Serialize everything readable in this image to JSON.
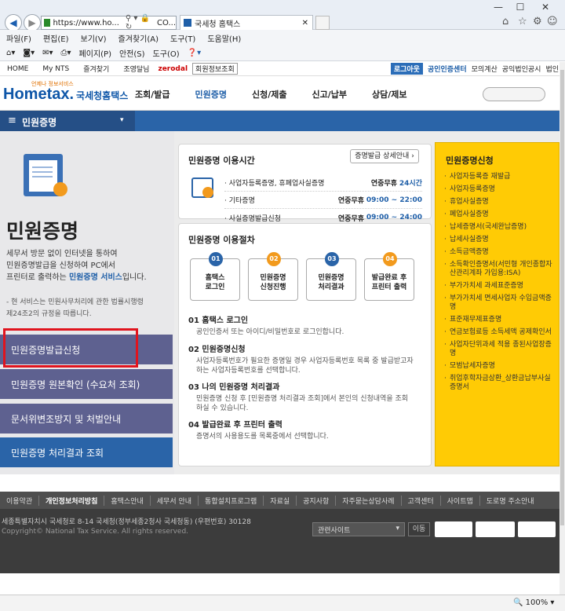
{
  "browser": {
    "address": "https://www.ho...",
    "address_extra": "CO...",
    "tab_title": "국세청 홈택스",
    "menu": [
      "파일(F)",
      "편집(E)",
      "보기(V)",
      "즐겨찾기(A)",
      "도구(T)",
      "도움말(H)"
    ],
    "commands": [
      "페이지(P)",
      "안전(S)",
      "도구(O)"
    ],
    "zoom": "100%"
  },
  "util_bar": {
    "items": [
      "HOME",
      "My NTS",
      "즐겨찾기",
      "조영달님",
      "zerodal",
      "회원정보조회"
    ],
    "right": [
      "로그아웃",
      "공인인증센터",
      "모의계산",
      "공익법인공시",
      "법인"
    ]
  },
  "header": {
    "logo": "Hometax.",
    "logo_small": "국세청홈택스",
    "logo_top": "언제나 정보서비스",
    "nav": [
      "조회/발급",
      "민원증명",
      "신청/제출",
      "신고/납부",
      "상담/제보"
    ]
  },
  "menubar": {
    "current": "민원증명"
  },
  "left": {
    "title": "민원증명",
    "desc1": "세무서 방문 없이 인터넷을 통하여",
    "desc2": "민원증명발급을 신청하여 PC에서",
    "desc3_pre": "프린터로 출력하는 ",
    "desc3_link": "민원증명 서비스",
    "desc3_post": "입니다.",
    "note1": "- 현 서비스는 민원사무처리에 관한 법률시행령",
    "note2": "제24조2의 규정을 따릅니다.",
    "buttons": [
      "민원증명발급신청",
      "민원증명 원본확인 (수요처 조회)",
      "문서위변조방지 및 처벌안내",
      "민원증명 처리결과 조회"
    ]
  },
  "hours": {
    "title": "민원증명 이용시간",
    "detail_button": "증명발급 상세안내",
    "rows": [
      {
        "name": "사업자등록증명, 휴폐업사실증명",
        "label": "연중무휴",
        "time": "24시간"
      },
      {
        "name": "기타증명",
        "label": "연중무휴",
        "time": "09:00 ~ 22:00"
      },
      {
        "name": "사실증명발급신청",
        "label": "연중무휴",
        "time": "09:00 ~ 24:00"
      }
    ]
  },
  "procedure": {
    "title": "민원증명 이용절차",
    "steps": [
      {
        "num": "01",
        "line1": "홈택스",
        "line2": "로그인",
        "color": "#2a64a8"
      },
      {
        "num": "02",
        "line1": "민원증명",
        "line2": "신청진행",
        "color": "#f29a1d"
      },
      {
        "num": "03",
        "line1": "민원증명",
        "line2": "처리결과",
        "color": "#2a64a8"
      },
      {
        "num": "04",
        "line1": "발급완료 후",
        "line2": "프린터 출력",
        "color": "#f29a1d"
      }
    ],
    "details": [
      {
        "title": "01 홈택스 로그인",
        "text1": "공인인증서 또는 아이디/비밀번호로 로그인합니다.",
        "text2": ""
      },
      {
        "title": "02 민원증명신청",
        "text1": "사업자등록번호가 필요한 증명일 경우 사업자등록번호 목록 중 발급받고자",
        "text2": "하는 사업자등록번호를 선택합니다."
      },
      {
        "title": "03 나의 민원증명 처리결과",
        "text1": "민원증명 신청 후 [민원증명 처리결과 조회]에서 본인의 신청내역을 조회",
        "text2": "하실 수 있습니다."
      },
      {
        "title": "04 발급완료 후 프린터 출력",
        "text1": "증명서의 사용용도를 목록중에서 선택합니다.",
        "text2": ""
      }
    ]
  },
  "apply": {
    "title": "민원증명신청",
    "items": [
      "사업자등록증 재발급",
      "사업자등록증명",
      "휴업사실증명",
      "폐업사실증명",
      "납세증명서(국세완납증명)",
      "납세사실증명",
      "소득금액증명",
      "소득확인증명서(서민형 개인종합자산관리계좌 가입용:ISA)",
      "부가가치세 과세표준증명",
      "부가가치세 면세사업자 수입금액증명",
      "표준재무제표증명",
      "연금보험료등 소득세액 공제확인서",
      "사업자단위과세 적용 종된사업장증명",
      "모범납세자증명",
      "취업후학자금상환_상환금납부사실증명서"
    ]
  },
  "footer": {
    "links": [
      "이용약관",
      "개인정보처리방침",
      "홈택스안내",
      "세무서 안내",
      "통합설치프로그램",
      "자료실",
      "공지사항",
      "자주묻는상담사례",
      "고객센터",
      "사이트맵",
      "도로명 주소안내"
    ],
    "address": "세종특별자치시 국세청로 8-14 국세청(정부세종2청사 국세청동) (우편번호) 30128",
    "copyright": "Copyright© National Tax Service.  All rights reserved.",
    "related": "관련사이트",
    "go": "이동"
  }
}
